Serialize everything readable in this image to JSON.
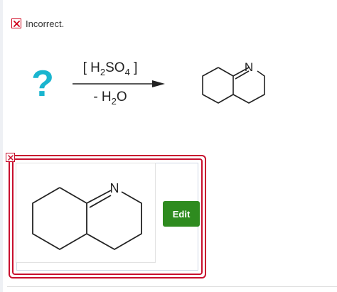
{
  "status": {
    "text": "Incorrect.",
    "icon": "close-icon",
    "color": "#d0021b"
  },
  "question": {
    "mark": "?",
    "color": "#1ab5cf"
  },
  "reaction": {
    "reagent_parts": [
      "[ H",
      "2",
      "SO",
      "4",
      " ]"
    ],
    "byproduct_parts": [
      "- H",
      "2",
      "O"
    ],
    "product_atom_label": "N"
  },
  "answer": {
    "atom_label": "N",
    "edit_label": "Edit",
    "edit_color": "#2e8b1f",
    "frame_color": "#c8102e"
  }
}
